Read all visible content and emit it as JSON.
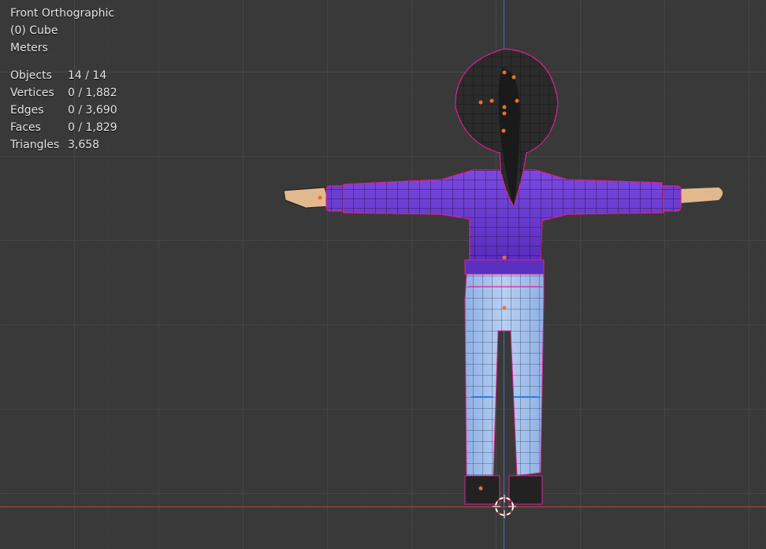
{
  "viewport": {
    "view_name": "Front Orthographic",
    "active_object": "(0) Cube",
    "units": "Meters"
  },
  "statistics": [
    {
      "label": "Objects",
      "value": "14 / 14"
    },
    {
      "label": "Vertices",
      "value": "0 / 1,882"
    },
    {
      "label": "Edges",
      "value": "0 / 3,690"
    },
    {
      "label": "Faces",
      "value": "0 / 1,829"
    },
    {
      "label": "Triangles",
      "value": "3,658"
    }
  ],
  "colors": {
    "background": "#393939",
    "x_axis": "#b5424a",
    "z_axis": "#3f6fb0",
    "shirt": "#6a3fd0",
    "jeans": "#a9c4ee",
    "hair": "#2a2a2a",
    "skin": "#e2b98f",
    "selection_outline": "#e0208f",
    "origin_dot": "#f07020"
  },
  "icons": {
    "cursor": "3d-cursor-icon"
  }
}
